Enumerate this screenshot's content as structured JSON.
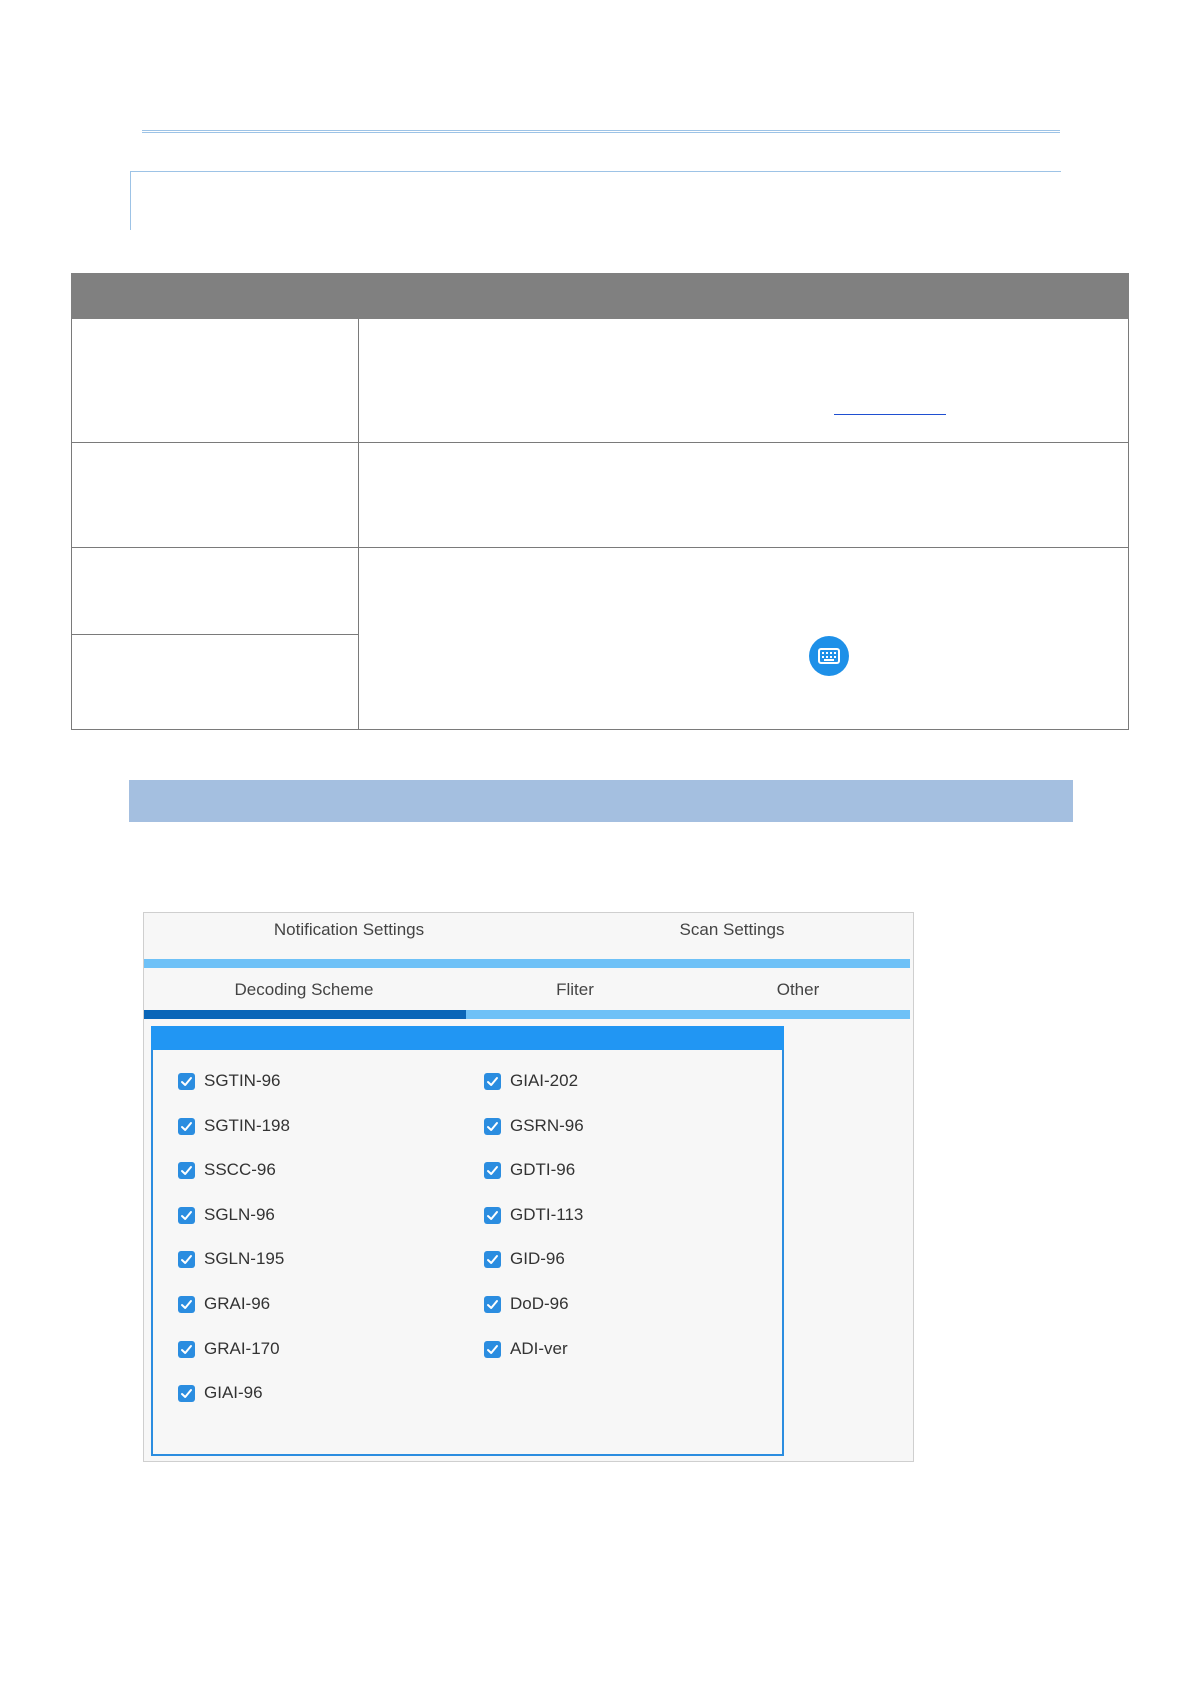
{
  "app": {
    "top_tabs": [
      {
        "label": "Notification Settings"
      },
      {
        "label": "Scan Settings"
      }
    ],
    "sub_tabs": [
      {
        "label": "Decoding Scheme",
        "active": true
      },
      {
        "label": "Fliter"
      },
      {
        "label": "Other"
      }
    ],
    "schemes_left": [
      {
        "label": "SGTIN-96",
        "checked": true
      },
      {
        "label": "SGTIN-198",
        "checked": true
      },
      {
        "label": "SSCC-96",
        "checked": true
      },
      {
        "label": "SGLN-96",
        "checked": true
      },
      {
        "label": "SGLN-195",
        "checked": true
      },
      {
        "label": "GRAI-96",
        "checked": true
      },
      {
        "label": "GRAI-170",
        "checked": true
      },
      {
        "label": "GIAI-96",
        "checked": true
      }
    ],
    "schemes_right": [
      {
        "label": "GIAI-202",
        "checked": true
      },
      {
        "label": "GSRN-96",
        "checked": true
      },
      {
        "label": "GDTI-96",
        "checked": true
      },
      {
        "label": "GDTI-113",
        "checked": true
      },
      {
        "label": "GID-96",
        "checked": true
      },
      {
        "label": "DoD-96",
        "checked": true
      },
      {
        "label": "ADI-ver",
        "checked": true
      }
    ]
  },
  "colors": {
    "accent": "#2196f3",
    "tab_underline": "#6ec1f7",
    "tab_active": "#0a66b8",
    "table_header": "#808080",
    "section_bar": "#a4bfe0"
  }
}
